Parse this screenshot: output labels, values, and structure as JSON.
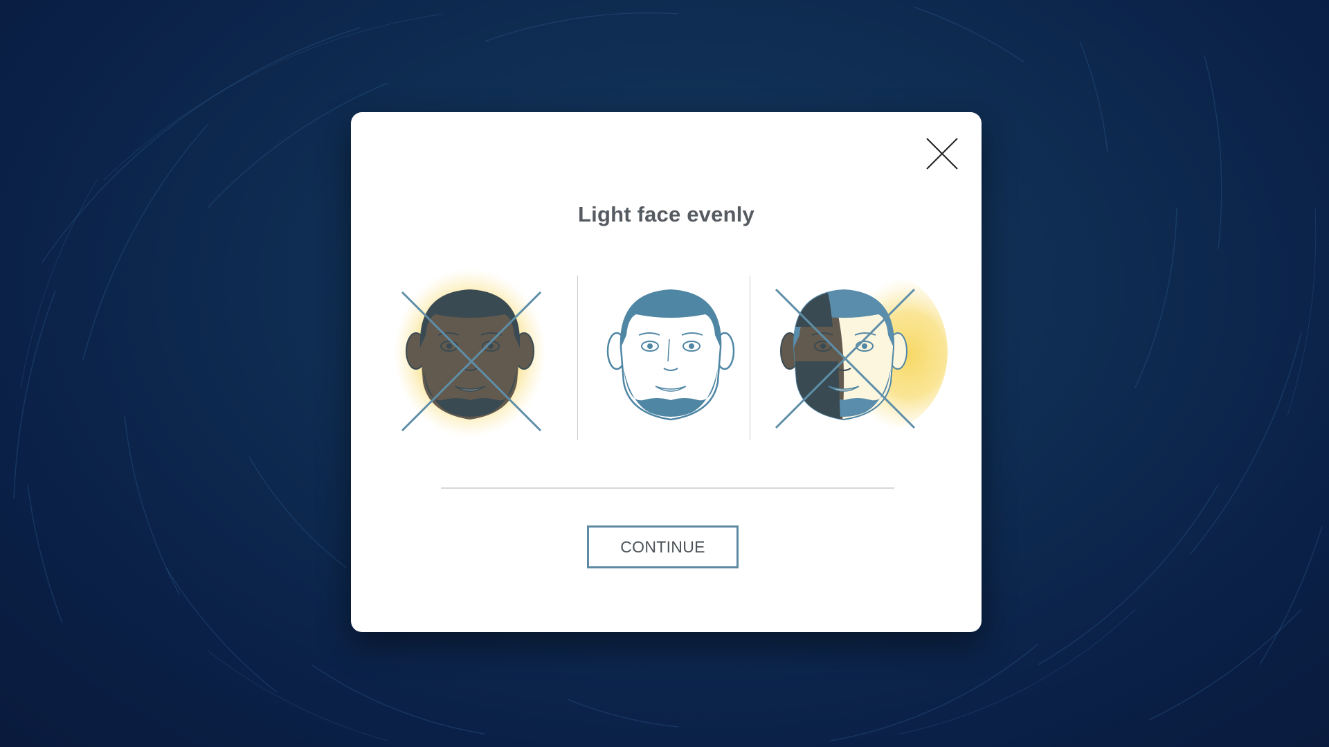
{
  "modal": {
    "title": "Light face evenly",
    "continue_label": "CONTINUE"
  },
  "faces": [
    {
      "name": "dark-face",
      "lighting": "backlit",
      "correct": false
    },
    {
      "name": "even-face",
      "lighting": "even",
      "correct": true
    },
    {
      "name": "side-lit-face",
      "lighting": "side",
      "correct": false
    }
  ],
  "colors": {
    "accent": "#5e8aa3",
    "face_outline": "#4f86a4",
    "glow": "#f7d866",
    "dark_skin": "#625a4f",
    "hair_dark": "#3a4a52",
    "cross": "#5f8ea8",
    "title_text": "#555b61"
  }
}
